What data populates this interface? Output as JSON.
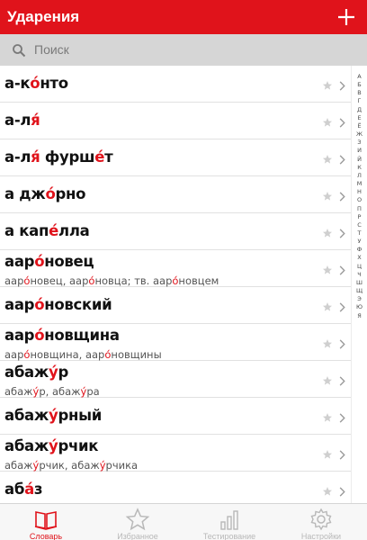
{
  "app": {
    "title": "Ударения"
  },
  "search": {
    "placeholder": "Поиск"
  },
  "colors": {
    "accent": "#e0131b",
    "search_bg": "#d6d6d6",
    "tab_inactive": "#b8b8b8"
  },
  "list": {
    "items": [
      {
        "word": [
          [
            "а-к",
            false
          ],
          [
            "о́",
            true
          ],
          [
            "нто",
            false
          ]
        ],
        "forms": null
      },
      {
        "word": [
          [
            "а-л",
            false
          ],
          [
            "я́",
            true
          ]
        ],
        "forms": null
      },
      {
        "word": [
          [
            "а-л",
            false
          ],
          [
            "я́",
            true
          ],
          [
            " фурш",
            false
          ],
          [
            "е́",
            true
          ],
          [
            "т",
            false
          ]
        ],
        "forms": null
      },
      {
        "word": [
          [
            "а дж",
            false
          ],
          [
            "о́",
            true
          ],
          [
            "рно",
            false
          ]
        ],
        "forms": null
      },
      {
        "word": [
          [
            "а кап",
            false
          ],
          [
            "е́",
            true
          ],
          [
            "лла",
            false
          ]
        ],
        "forms": null
      },
      {
        "word": [
          [
            "аар",
            false
          ],
          [
            "о́",
            true
          ],
          [
            "новец",
            false
          ]
        ],
        "forms": [
          [
            "аар",
            false
          ],
          [
            "о́",
            true
          ],
          [
            "новец, аар",
            false
          ],
          [
            "о́",
            true
          ],
          [
            "новца; тв. аар",
            false
          ],
          [
            "о́",
            true
          ],
          [
            "новцем",
            false
          ]
        ]
      },
      {
        "word": [
          [
            "аар",
            false
          ],
          [
            "о́",
            true
          ],
          [
            "новский",
            false
          ]
        ],
        "forms": null
      },
      {
        "word": [
          [
            "аар",
            false
          ],
          [
            "о́",
            true
          ],
          [
            "новщина",
            false
          ]
        ],
        "forms": [
          [
            "аар",
            false
          ],
          [
            "о́",
            true
          ],
          [
            "новщина, аар",
            false
          ],
          [
            "о́",
            true
          ],
          [
            "новщины",
            false
          ]
        ]
      },
      {
        "word": [
          [
            "абаж",
            false
          ],
          [
            "у́",
            true
          ],
          [
            "р",
            false
          ]
        ],
        "forms": [
          [
            "абаж",
            false
          ],
          [
            "у́",
            true
          ],
          [
            "р, абаж",
            false
          ],
          [
            "у́",
            true
          ],
          [
            "ра",
            false
          ]
        ]
      },
      {
        "word": [
          [
            "абаж",
            false
          ],
          [
            "у́",
            true
          ],
          [
            "рный",
            false
          ]
        ],
        "forms": null
      },
      {
        "word": [
          [
            "абаж",
            false
          ],
          [
            "у́",
            true
          ],
          [
            "рчик",
            false
          ]
        ],
        "forms": [
          [
            "абаж",
            false
          ],
          [
            "у́",
            true
          ],
          [
            "рчик, абаж",
            false
          ],
          [
            "у́",
            true
          ],
          [
            "рчика",
            false
          ]
        ]
      },
      {
        "word": [
          [
            "аб",
            false
          ],
          [
            "а́",
            true
          ],
          [
            "з",
            false
          ]
        ],
        "forms": null
      }
    ]
  },
  "alphabet": [
    "А",
    "Б",
    "В",
    "Г",
    "Д",
    "Е",
    "Ё",
    "Ж",
    "З",
    "И",
    "Й",
    "К",
    "Л",
    "М",
    "Н",
    "О",
    "П",
    "Р",
    "С",
    "Т",
    "У",
    "Ф",
    "Х",
    "Ц",
    "Ч",
    "Ш",
    "Щ",
    "Э",
    "Ю",
    "Я"
  ],
  "tabs": [
    {
      "label": "Словарь",
      "icon": "book-icon",
      "active": true
    },
    {
      "label": "Избранное",
      "icon": "star-icon",
      "active": false
    },
    {
      "label": "Тестирование",
      "icon": "bar-chart-icon",
      "active": false
    },
    {
      "label": "Настройки",
      "icon": "gear-icon",
      "active": false
    }
  ]
}
